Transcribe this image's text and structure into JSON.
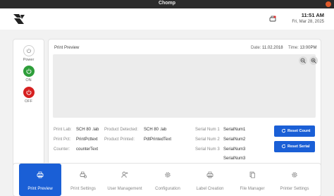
{
  "window": {
    "title": "Chomp"
  },
  "header": {
    "time": "11:51 AM",
    "date": "Fri, Mar 28, 2025",
    "status_icon": "printer-status-icon"
  },
  "power": {
    "power_label": "Power",
    "on_label": "ON",
    "off_label": "OFF",
    "on_color": "#2e9e3a",
    "off_color": "#d62020"
  },
  "preview": {
    "title": "Print Preview",
    "date_label": "Date:",
    "date_value": "11.02.2018",
    "time_label": "Time:",
    "time_value": "13:00PM"
  },
  "info": {
    "print_lab_label": "Print Lab:",
    "print_lab_value": "SCH 80 .lab",
    "print_pct_label": "Print Pct:",
    "print_pct_value": "PrintPcttext",
    "counter_label": "Counter:",
    "counter_value": "counterText",
    "product_detected_label": "Product Detected:",
    "product_detected_value": "SCH 80 .lab",
    "product_printed_label": "Product Printed:",
    "product_printed_value": "PdtPrintedText",
    "serials": [
      {
        "label": "Serial Num 1",
        "value": "SerialNum1"
      },
      {
        "label": "Serial Num 2",
        "value": "SerialNum2"
      },
      {
        "label": "Serial Num 3",
        "value": "SerialNum3"
      },
      {
        "label": "",
        "value": "SerialNum3"
      }
    ]
  },
  "actions": {
    "reset_count": "Reset Count",
    "reset_serial": "Reset Serial"
  },
  "nav": {
    "items": [
      {
        "label": "Print Preview",
        "icon": "printer-icon",
        "active": true
      },
      {
        "label": "Print Settings",
        "icon": "print-settings-icon",
        "active": false
      },
      {
        "label": "User Management",
        "icon": "user-add-icon",
        "active": false
      },
      {
        "label": "Configuration",
        "icon": "gear-icon",
        "active": false
      },
      {
        "label": "Label Creation",
        "icon": "printer-icon",
        "active": false
      },
      {
        "label": "File Manager",
        "icon": "file-manager-icon",
        "active": false
      },
      {
        "label": "Printer Settings",
        "icon": "gear-icon",
        "active": false
      }
    ],
    "accent": "#1a5fd6"
  }
}
